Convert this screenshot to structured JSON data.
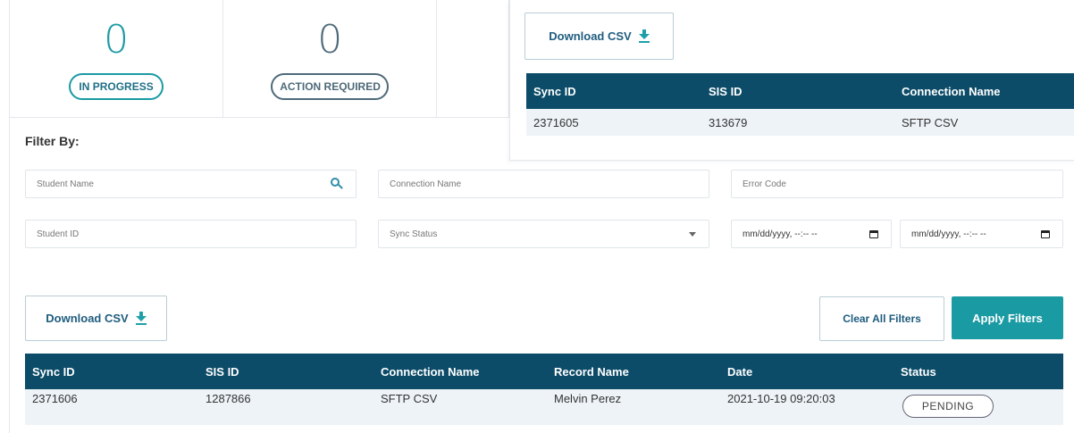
{
  "stats": [
    {
      "count": "0",
      "label": "IN PROGRESS"
    },
    {
      "count": "0",
      "label": "ACTION REQUIRED"
    }
  ],
  "popup": {
    "download_label": "Download CSV",
    "columns": [
      "Sync ID",
      "SIS ID",
      "Connection Name"
    ],
    "rows": [
      [
        "2371605",
        "313679",
        "SFTP CSV"
      ]
    ]
  },
  "filters": {
    "title": "Filter By:",
    "student_name_placeholder": "Student Name",
    "connection_name_placeholder": "Connection Name",
    "error_code_placeholder": "Error Code",
    "student_id_placeholder": "Student ID",
    "sync_status_placeholder": "Sync Status",
    "date_from_placeholder": "mm/dd/yyyy, --:-- --",
    "date_to_placeholder": "mm/dd/yyyy, --:-- --"
  },
  "actions": {
    "download_label": "Download CSV",
    "clear_label": "Clear All Filters",
    "apply_label": "Apply Filters"
  },
  "results": {
    "columns": [
      "Sync ID",
      "SIS ID",
      "Connection Name",
      "Record Name",
      "Date",
      "Status"
    ],
    "rows": [
      [
        "2371606",
        "1287866",
        "SFTP CSV",
        "Melvin Perez",
        "2021-10-19 09:20:03",
        "PENDING"
      ]
    ]
  },
  "colors": {
    "accent": "#1a9aa3",
    "header": "#0c4c69",
    "slate": "#4e6a79"
  },
  "icons": [
    "download-icon",
    "search-icon",
    "chevron-down-icon",
    "calendar-icon"
  ]
}
